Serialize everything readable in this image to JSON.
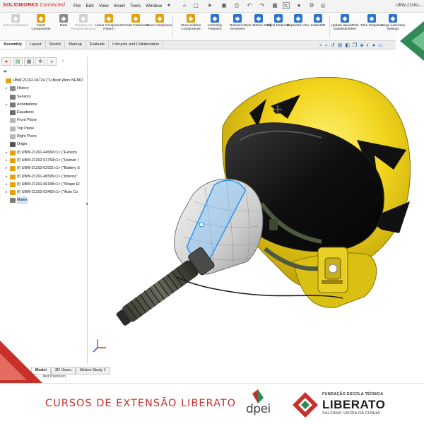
{
  "app": {
    "logo_brand": "SOLIDWORKS",
    "logo_suffix": " Connected",
    "window_title": "UBW-21162-..."
  },
  "menu": [
    "File",
    "Edit",
    "View",
    "Insert",
    "Tools",
    "Window"
  ],
  "ribbon": [
    {
      "label": "Edit Component",
      "icon": "edit-component-icon",
      "enabled": false
    },
    {
      "label": "Insert Components",
      "icon": "insert-components-icon",
      "enabled": true
    },
    {
      "label": "Mate",
      "icon": "mate-icon",
      "enabled": true
    },
    {
      "label": "Component Preview Window",
      "icon": "preview-window-icon",
      "enabled": false
    },
    {
      "label": "Linear Component Pattern",
      "icon": "linear-pattern-icon",
      "enabled": true
    },
    {
      "label": "Smart Fasteners",
      "icon": "smart-fasteners-icon",
      "enabled": true
    },
    {
      "label": "Move Component",
      "icon": "move-component-icon",
      "enabled": true
    },
    {
      "label": "Show Hidden Components",
      "icon": "show-hidden-icon",
      "enabled": true
    },
    {
      "label": "Assembly Features",
      "icon": "assembly-features-icon",
      "enabled": true
    },
    {
      "label": "Reference Geometry",
      "icon": "reference-geometry-icon",
      "enabled": true
    },
    {
      "label": "New Motion Study",
      "icon": "motion-study-icon",
      "enabled": true
    },
    {
      "label": "Bill of Materials",
      "icon": "bom-icon",
      "enabled": true
    },
    {
      "label": "Exploded View",
      "icon": "exploded-view-icon",
      "enabled": true
    },
    {
      "label": "Instant3D",
      "icon": "instant3d-icon",
      "enabled": true
    },
    {
      "label": "Update SpeedPak Subassemblies",
      "icon": "speedpak-icon",
      "enabled": true
    },
    {
      "label": "Take Snapshot",
      "icon": "snapshot-icon",
      "enabled": true
    },
    {
      "label": "Large Assembly Settings",
      "icon": "large-assembly-icon",
      "enabled": true
    }
  ],
  "command_tabs": [
    "Assembly",
    "Layout",
    "Sketch",
    "Markup",
    "Evaluate",
    "Lifecycle and Collaboration"
  ],
  "active_tab": "Assembly",
  "tree": [
    {
      "label": "UBW-21162-04724 (\"U-Boat Worx NEMO",
      "icon": "assembly-icon",
      "color": "#e3a10f",
      "level": 0,
      "expand": ""
    },
    {
      "label": "History",
      "icon": "history-icon",
      "color": "#8a8a8a",
      "level": 1,
      "expand": "▸"
    },
    {
      "label": "Sensors",
      "icon": "sensors-icon",
      "color": "#7a7a7a",
      "level": 1,
      "expand": ""
    },
    {
      "label": "Annotations",
      "icon": "annotations-icon",
      "color": "#7a7a7a",
      "level": 1,
      "expand": "▸"
    },
    {
      "label": "Equations",
      "icon": "equations-icon",
      "color": "#6d6d6d",
      "level": 1,
      "expand": ""
    },
    {
      "label": "Front Plane",
      "icon": "plane-icon",
      "color": "#b9b9b9",
      "level": 1,
      "expand": ""
    },
    {
      "label": "Top Plane",
      "icon": "plane-icon",
      "color": "#b9b9b9",
      "level": 1,
      "expand": ""
    },
    {
      "label": "Right Plane",
      "icon": "plane-icon",
      "color": "#b9b9b9",
      "level": 1,
      "expand": ""
    },
    {
      "label": "Origin",
      "icon": "origin-icon",
      "color": "#555555",
      "level": 1,
      "expand": ""
    },
    {
      "label": "(f) UBW-21161-44582<1> (\"Exostru",
      "icon": "part-icon",
      "color": "#e3a10f",
      "level": 1,
      "expand": "▸"
    },
    {
      "label": "(f) UBW-21162-01769<1> (\"Human I",
      "icon": "part-icon",
      "color": "#e3a10f",
      "level": 1,
      "expand": "▸"
    },
    {
      "label": "(f) UBW-21162-02921<1> (\"Battery S",
      "icon": "part-icon",
      "color": "#e3a10f",
      "level": 1,
      "expand": "▸"
    },
    {
      "label": "(f) UBW-21161-46595<1> (\"Interior\"",
      "icon": "part-icon",
      "color": "#e3a10f",
      "level": 1,
      "expand": "▸"
    },
    {
      "label": "(f) UBW-21161-66188<1> (\"Shape El",
      "icon": "part-icon",
      "color": "#e3a10f",
      "level": 1,
      "expand": "▸"
    },
    {
      "label": "(f) UBW-21162-03465<1> (\"Auto Co",
      "icon": "part-icon",
      "color": "#e3a10f",
      "level": 1,
      "expand": "▸"
    },
    {
      "label": "Mates",
      "icon": "mates-icon",
      "color": "#7a7a7a",
      "level": 1,
      "expand": "",
      "selected": true
    }
  ],
  "bottom_tabs": [
    "Model",
    "3D Views",
    "Motion Study 1"
  ],
  "status_text": "...ited Premium",
  "footer": {
    "course": "CURSOS DE EXTENSÃO LIBERATO",
    "dpei": "dpei",
    "lib_top": "FUNDAÇÃO ESCOLA TÉCNICA",
    "lib_name": "LIBERATO",
    "lib_sub": "SALZANO VIEIRA DA CUNHA"
  },
  "colors": {
    "brand_red": "#c8302a",
    "brand_green": "#2f8a57",
    "helmet_yellow": "#f2d51c",
    "selection_blue": "#cfe3fb"
  }
}
